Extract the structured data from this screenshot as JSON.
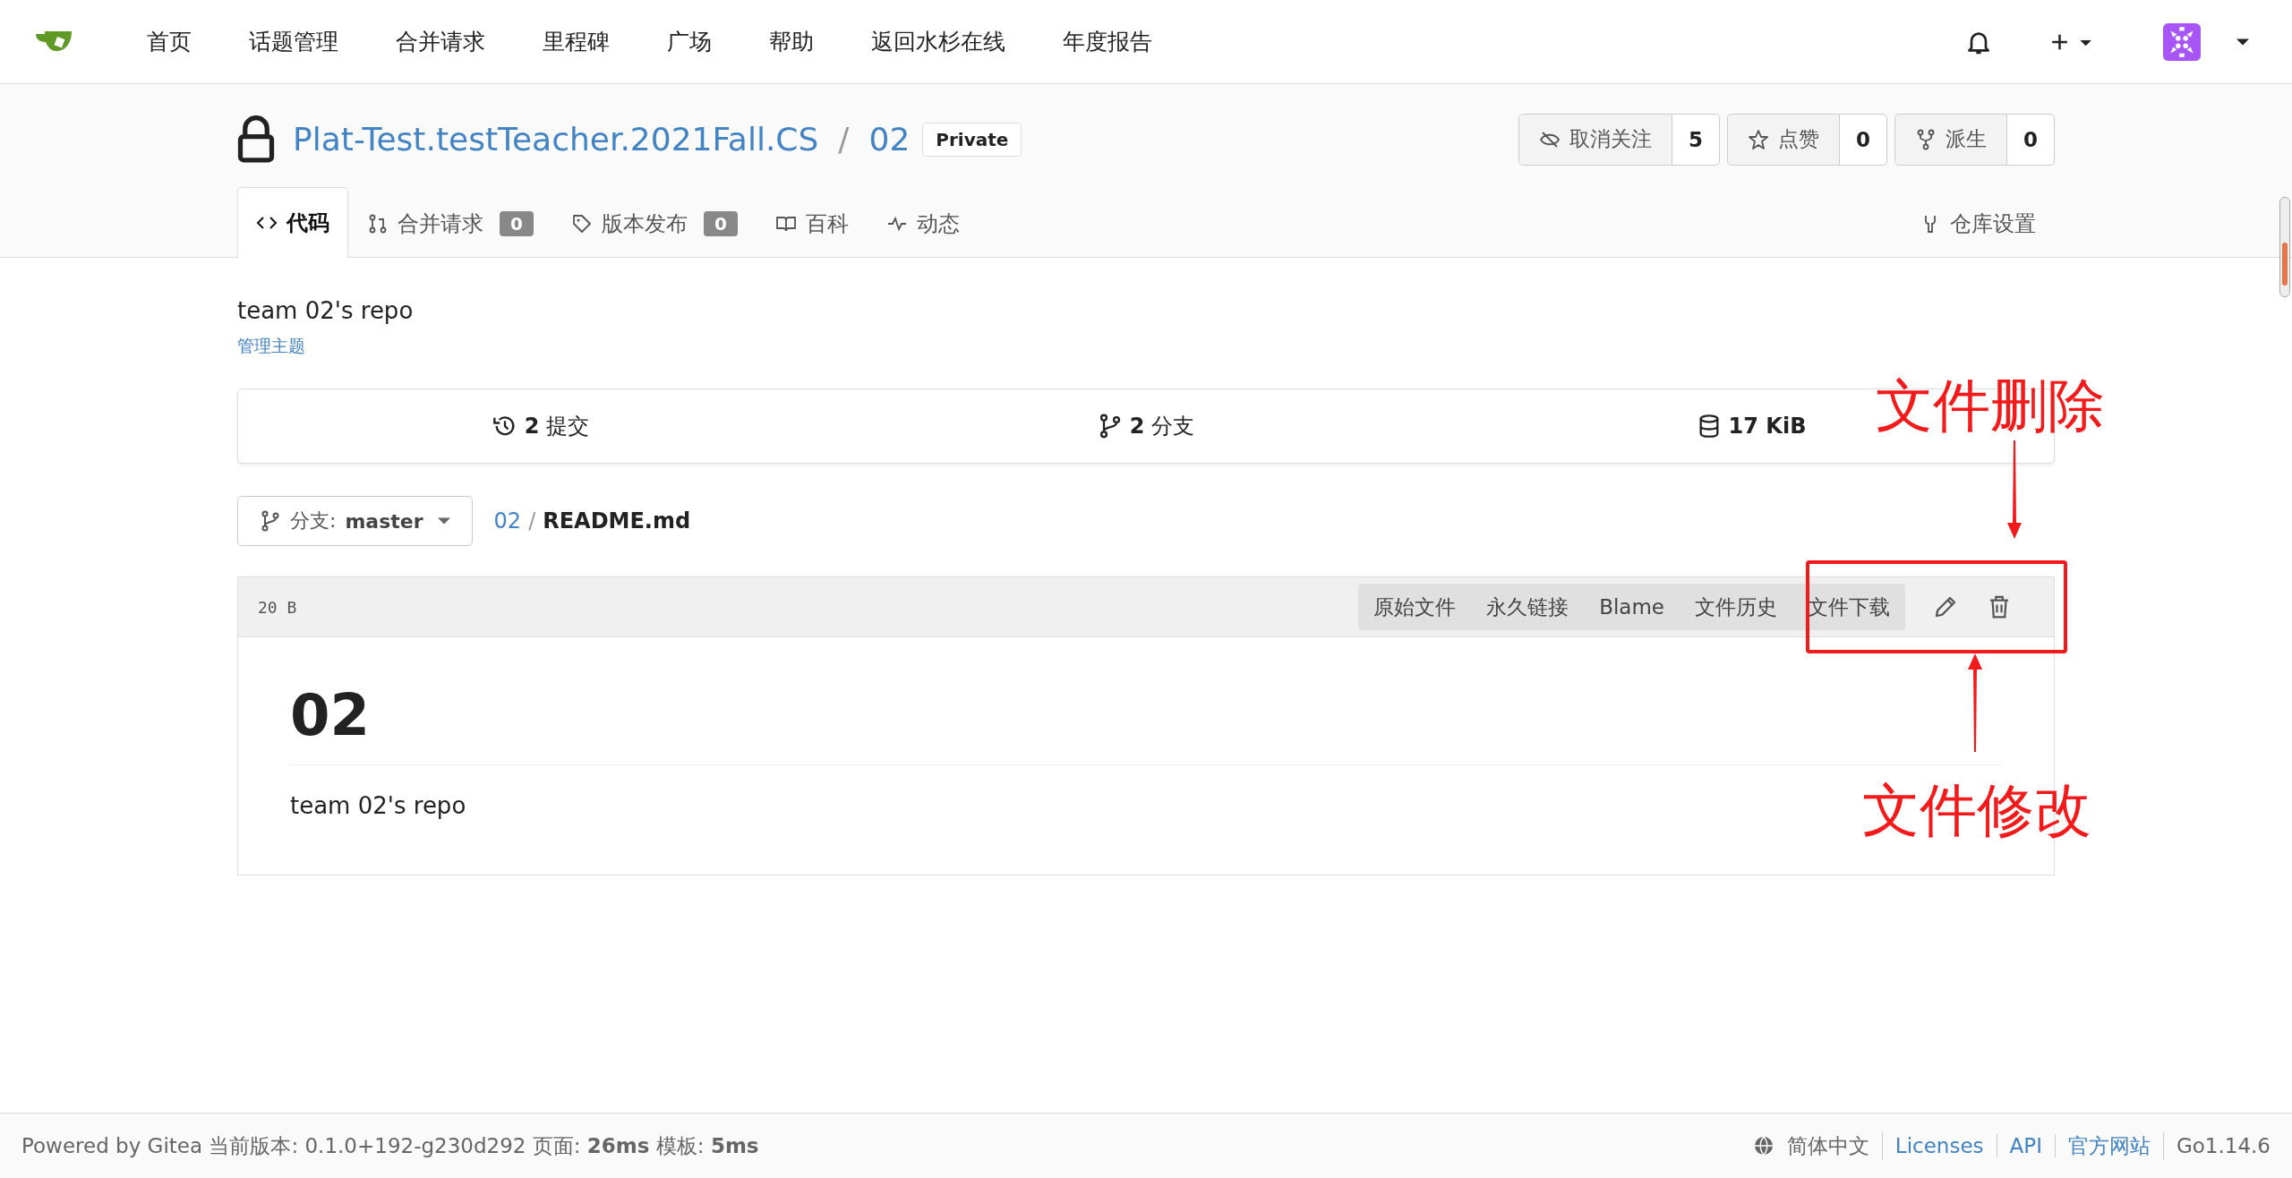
{
  "nav": {
    "items": [
      "首页",
      "话题管理",
      "合并请求",
      "里程碑",
      "广场",
      "帮助",
      "返回水杉在线",
      "年度报告"
    ]
  },
  "repo": {
    "owner": "Plat-Test.testTeacher.2021Fall.CS",
    "separator": "/",
    "name": "02",
    "badge": "Private",
    "buttons": [
      {
        "kind": "watch",
        "label": "取消关注",
        "count": "5"
      },
      {
        "kind": "star",
        "label": "点赞",
        "count": "0"
      },
      {
        "kind": "fork",
        "label": "派生",
        "count": "0"
      }
    ],
    "tabs": [
      {
        "kind": "code",
        "label": "代码",
        "selected": true
      },
      {
        "kind": "pr",
        "label": "合并请求",
        "count": "0",
        "selected": false
      },
      {
        "kind": "tag",
        "label": "版本发布",
        "count": "0",
        "selected": false
      },
      {
        "kind": "wiki",
        "label": "百科",
        "selected": false
      },
      {
        "kind": "activity",
        "label": "动态",
        "selected": false
      }
    ],
    "settings_tab": {
      "label": "仓库设置"
    }
  },
  "description": "team 02's repo",
  "topics_link": "管理主题",
  "stats": [
    {
      "kind": "commits",
      "value": "2",
      "label": "提交"
    },
    {
      "kind": "branches",
      "value": "2",
      "label": "分支"
    },
    {
      "kind": "size",
      "value": "17 KiB"
    }
  ],
  "branch": {
    "label": "分支:",
    "name": "master"
  },
  "path": {
    "folder": "02",
    "separator": "/",
    "file": "README.md"
  },
  "file": {
    "size": "20 B",
    "actions": [
      "原始文件",
      "永久链接",
      "Blame",
      "文件历史",
      "文件下载"
    ],
    "heading": "02",
    "body": "team 02's repo"
  },
  "annotations": [
    {
      "kind": "delete",
      "text": "文件删除"
    },
    {
      "kind": "edit",
      "text": "文件修改"
    }
  ],
  "footer": {
    "powered": "Powered by Gitea 当前版本: 0.1.0+192-g230d292 页面: **26ms** 模板: **5ms**",
    "language": "简体中文",
    "links": [
      "Licenses",
      "API",
      "官方网站"
    ],
    "version": "Go1.14.6"
  }
}
